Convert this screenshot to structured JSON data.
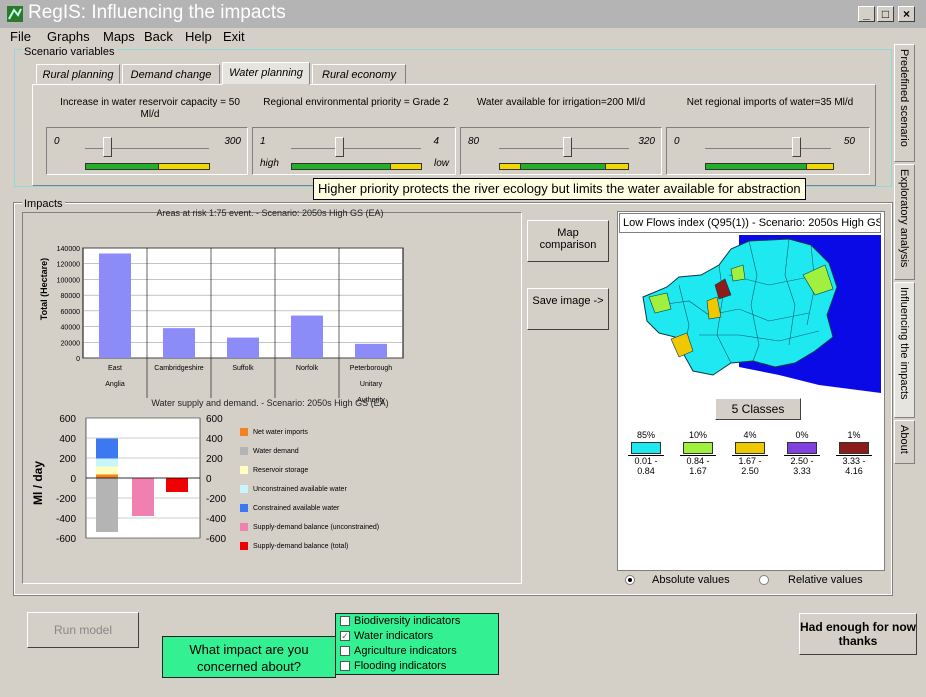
{
  "window": {
    "title": "RegIS: Influencing the impacts",
    "controls": [
      "_",
      "□",
      "×"
    ]
  },
  "menu": [
    "File",
    "Graphs",
    "Maps",
    "Back",
    "Help",
    "Exit"
  ],
  "scenario": {
    "legend": "Scenario variables",
    "tabs": [
      "Rural planning",
      "Demand change",
      "Water planning",
      "Rural economy"
    ],
    "active_tab": "Water planning",
    "variables": [
      {
        "label": "Increase in water reservoir capacity = 50 Ml/d",
        "min": "0",
        "max": "300",
        "value": 50,
        "range": [
          0,
          300
        ]
      },
      {
        "label": "Regional environmental priority = Grade 2",
        "min": "1",
        "max": "4",
        "low_label": "high",
        "high_label": "low",
        "value": 2,
        "range": [
          1,
          4
        ]
      },
      {
        "label": "Water available for irrigation=200 Ml/d",
        "min": "80",
        "max": "320",
        "value": 200,
        "range": [
          80,
          320
        ]
      },
      {
        "label": "Net regional imports of water=35 Ml/d",
        "min": "0",
        "max": "50",
        "value": 35,
        "range": [
          0,
          50
        ]
      }
    ],
    "tooltip": "Higher priority protects the river ecology but limits the water available for abstraction"
  },
  "side_tabs": [
    "Predefined scenario",
    "Exploratory analysis",
    "Influencing the impacts",
    "About"
  ],
  "impacts": {
    "legend": "Impacts",
    "map_comparison": "Map comparison",
    "save_image": "Save image ->"
  },
  "chart_data": [
    {
      "type": "bar",
      "title": "Areas at risk 1:75 event. - Scenario: 2050s High GS (EA)",
      "ylabel": "Total (Hectare)",
      "categories": [
        "East Anglia",
        "Cambridgeshire",
        "Suffolk",
        "Norfolk",
        "Peterborough Unitary Authority"
      ],
      "values": [
        133000,
        38000,
        26000,
        54000,
        18000
      ],
      "yticks": [
        "0",
        "20000",
        "40000",
        "60000",
        "80000",
        "100000",
        "120000",
        "140000"
      ],
      "ylim": [
        0,
        140000
      ],
      "color": "#8c8cf8"
    },
    {
      "type": "bar",
      "title": "Water supply and demand. - Scenario: 2050s High GS (EA)",
      "ylabel": "Ml / day",
      "yticks": [
        "600",
        "400",
        "200",
        "0",
        "-200",
        "-400",
        "-600"
      ],
      "ylim": [
        -600,
        600
      ],
      "series": [
        {
          "name": "Net water imports",
          "color": "#f58220",
          "value": 35
        },
        {
          "name": "Water demand",
          "color": "#b4b4b4",
          "value": -540
        },
        {
          "name": "Reservoir storage",
          "color": "#ffffc0",
          "value": 80
        },
        {
          "name": "Unconstrained available water",
          "color": "#c8f4fc",
          "value": 80
        },
        {
          "name": "Constrained available water",
          "color": "#3c78f0",
          "value": 200
        },
        {
          "name": "Supply-demand balance (unconstrained)",
          "color": "#f080b0",
          "value": -380
        },
        {
          "name": "Supply-demand balance (total)",
          "color": "#f00000",
          "value": -140
        }
      ]
    }
  ],
  "map": {
    "title": "Low Flows index (Q95(1)) - Scenario: 2050s High GS",
    "classes_button": "5 Classes",
    "legend": [
      {
        "pct": "85%",
        "range": "0.01 - 0.84",
        "color": "#1ee8f0"
      },
      {
        "pct": "10%",
        "range": "0.84 - 1.67",
        "color": "#a0f040"
      },
      {
        "pct": "4%",
        "range": "1.67 - 2.50",
        "color": "#f0c800"
      },
      {
        "pct": "0%",
        "range": "2.50 - 3.33",
        "color": "#8040e0"
      },
      {
        "pct": "1%",
        "range": "3.33 - 4.16",
        "color": "#8c1c1c"
      }
    ],
    "radio_absolute": "Absolute values",
    "radio_relative": "Relative values",
    "sea_color": "#0a0ae6"
  },
  "bottom": {
    "run_model": "Run model",
    "question": "What impact are you concerned about?",
    "indicators": [
      {
        "label": "Biodiversity indicators",
        "checked": false
      },
      {
        "label": "Water indicators",
        "checked": true
      },
      {
        "label": "Agriculture indicators",
        "checked": false
      },
      {
        "label": "Flooding indicators",
        "checked": false
      }
    ],
    "done": "Had enough for now thanks"
  }
}
